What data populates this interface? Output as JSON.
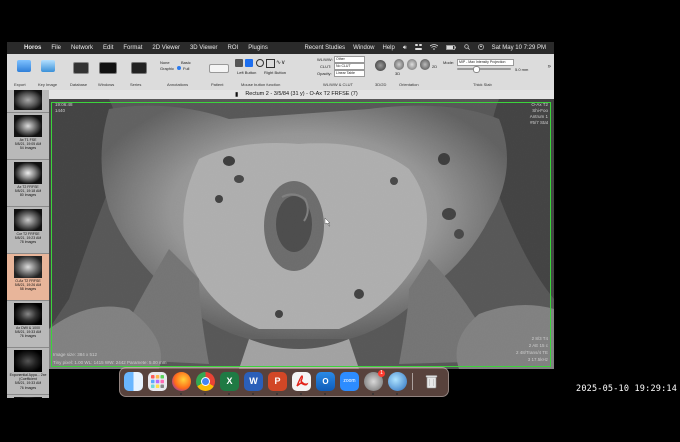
{
  "menubar": {
    "app": "Horos",
    "items": [
      "File",
      "Network",
      "Edit",
      "Format",
      "2D Viewer",
      "3D Viewer",
      "ROI",
      "Plugins"
    ],
    "right_items": [
      "Recent Studies",
      "Window",
      "Help"
    ],
    "datetime": "Sat May 10  7:29 PM"
  },
  "toolbar": {
    "labels": [
      "Export",
      "Key Image",
      "Database",
      "Windows",
      "Series",
      "Annotations",
      "Patient",
      "Mouse button function",
      "WL/WW & CLUT",
      "3D/2D",
      "Orientation",
      "Thick Slab"
    ],
    "annot_none": "None",
    "annot_basic": "Basic",
    "annot_graphic": "Graphic",
    "annot_full": "Full",
    "left_button": "Left Button",
    "right_button": "Right Button",
    "wlww_label": "WL/WW:",
    "wlww_value": "Other",
    "clut_label": "CLUT:",
    "clut_value": "No CLUT",
    "opacity_label": "Opacity:",
    "opacity_value": "Linear Table",
    "mode_label": "Mode:",
    "mode_value": "MIP - Max Intensity Projection",
    "thick_value": "5.0 mm",
    "orient_3d": "3D",
    "mpr_2d": "2D"
  },
  "viewer": {
    "title": "Rectum 2 - 3/5/84 (31 y) - O-Ax T2 FRFSE (7)"
  },
  "overlays": {
    "top_left": [
      "19:06:48",
      "1440"
    ],
    "top_right": [
      "O-Ax T2",
      "Shi-Foo",
      "Antrum 1",
      "#5/7 Stat"
    ],
    "bottom_left": [
      "Image size: 384 x 512",
      "Tiny pixel: 1.00 WL: 1415 WW: 2442 Paramete: 5.00 mm"
    ],
    "bottom_right": [
      "2 8/3 T4",
      "2 AE 15 c",
      "2 48/Trans/4 TE",
      "3 17.5kHz"
    ]
  },
  "series": [
    {
      "text": ""
    },
    {
      "text": "Ax T1 FSE\n5/8/21, 19:05 AM\n54 Images"
    },
    {
      "text": "Ax T2 FRFSE\n5/8/21, 19:18 AM\n80 Images"
    },
    {
      "text": "Cor T2 FRFSE\n5/8/21, 19:23 AM\n78 Images"
    },
    {
      "text": "O-Ax T2 FRFSE\n5/8/21, 19:26 AM\n58 Images"
    },
    {
      "text": "Ax DWI & 1000\n5/8/21, 19:33 AM\n76 Images"
    },
    {
      "text": "Exponential Appa... 2xe\n(Coefficient\n5/8/21, 19:33 AM\n76 Images"
    }
  ],
  "dock": {
    "apps": [
      "finder-icon",
      "launchpad-icon",
      "firefox-icon",
      "chrome-icon",
      "excel-icon",
      "word-icon",
      "powerpoint-icon",
      "acrobat-icon",
      "outlook-icon",
      "zoom-icon",
      "system-settings-icon",
      "horos-icon",
      "trash-icon"
    ],
    "zoom_label": "zoom",
    "settings_badge": "1"
  },
  "timestamp": "2025-05-10  19:29:14"
}
